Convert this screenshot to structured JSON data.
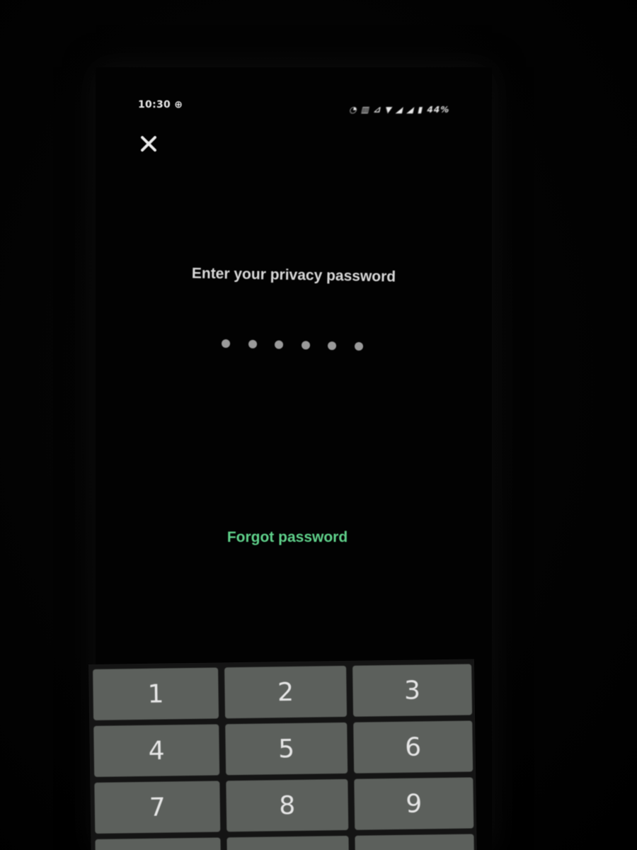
{
  "status_bar": {
    "time": "10:30",
    "time_icon": "notification-icon",
    "right_icons_text": "◔ ▥ ⊿ ▼ ◢ ◢ ▮ 44%"
  },
  "header": {
    "close_icon": "close-icon"
  },
  "prompt": {
    "title": "Enter your privacy password"
  },
  "password": {
    "dot_count": 6,
    "dot_color": "#9a9a9a"
  },
  "forgot": {
    "label": "Forgot password",
    "color": "#5fd08a"
  },
  "keypad": {
    "keys": [
      "1",
      "2",
      "3",
      "4",
      "5",
      "6",
      "7",
      "8",
      "9",
      "",
      "",
      ""
    ],
    "key_color": "#5c605c"
  }
}
